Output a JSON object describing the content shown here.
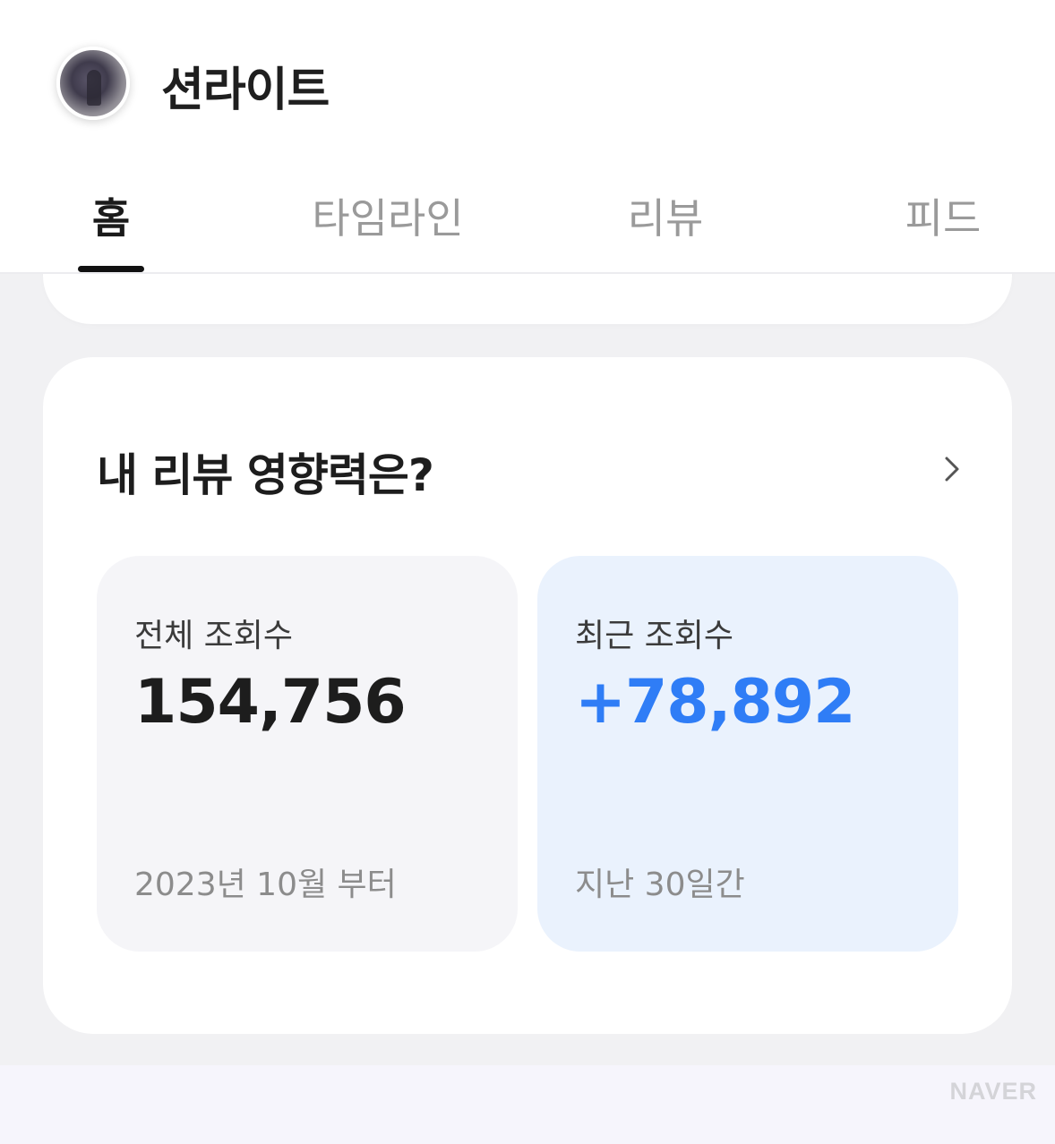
{
  "profile": {
    "name": "션라이트"
  },
  "tabs": [
    {
      "label": "홈",
      "active": true
    },
    {
      "label": "타임라인",
      "active": false
    },
    {
      "label": "리뷰",
      "active": false
    },
    {
      "label": "피드",
      "active": false
    }
  ],
  "influence": {
    "title": "내 리뷰 영향력은?",
    "total": {
      "label": "전체 조회수",
      "value": "154,756",
      "since": "2023년 10월 부터"
    },
    "recent": {
      "label": "최근 조회수",
      "value": "+78,892",
      "period": "지난 30일간"
    }
  },
  "watermark": "NAVER",
  "colors": {
    "accent": "#2f7df6",
    "recent_card_bg": "#eaf2fd",
    "total_card_bg": "#f5f5f8"
  }
}
